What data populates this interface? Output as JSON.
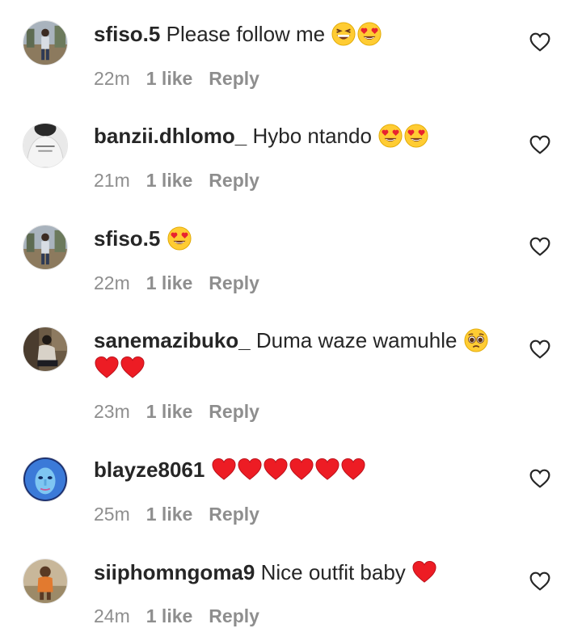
{
  "comments": [
    {
      "username": "sfiso.5",
      "text": "Please follow me",
      "emojis": [
        "grinning-squint-emoji",
        "heart-eyes-emoji"
      ],
      "time": "22m",
      "likes": "1 like",
      "reply": "Reply",
      "avatar": "photo-person-outdoor-avatar"
    },
    {
      "username": "banzii.dhlomo_",
      "text": "Hybo ntando",
      "emojis": [
        "heart-eyes-emoji",
        "heart-eyes-emoji"
      ],
      "time": "21m",
      "likes": "1 like",
      "reply": "Reply",
      "avatar": "photo-bw-shirt-avatar"
    },
    {
      "username": "sfiso.5",
      "text": "",
      "emojis": [
        "heart-eyes-emoji"
      ],
      "time": "22m",
      "likes": "1 like",
      "reply": "Reply",
      "avatar": "photo-person-outdoor-avatar"
    },
    {
      "username": "sanemazibuko_",
      "text": "Duma waze wamuhle",
      "emojis": [
        "pleading-face-emoji",
        "red-heart-emoji",
        "red-heart-emoji"
      ],
      "time": "23m",
      "likes": "1 like",
      "reply": "Reply",
      "avatar": "photo-person-sitting-avatar"
    },
    {
      "username": "blayze8061",
      "text": "",
      "emojis": [
        "red-heart-emoji",
        "red-heart-emoji",
        "red-heart-emoji",
        "red-heart-emoji",
        "red-heart-emoji",
        "red-heart-emoji"
      ],
      "time": "25m",
      "likes": "1 like",
      "reply": "Reply",
      "avatar": "photo-blue-face-avatar"
    },
    {
      "username": "siiphomngoma9",
      "text": "Nice outfit baby",
      "emojis": [
        "red-heart-emoji"
      ],
      "time": "24m",
      "likes": "1 like",
      "reply": "Reply",
      "avatar": "photo-child-avatar"
    }
  ],
  "icons": {
    "like": "heart-outline-icon"
  },
  "colors": {
    "text": "#262626",
    "secondary": "#8e8e8e",
    "heart": "#ed1c24",
    "background": "#ffffff"
  }
}
